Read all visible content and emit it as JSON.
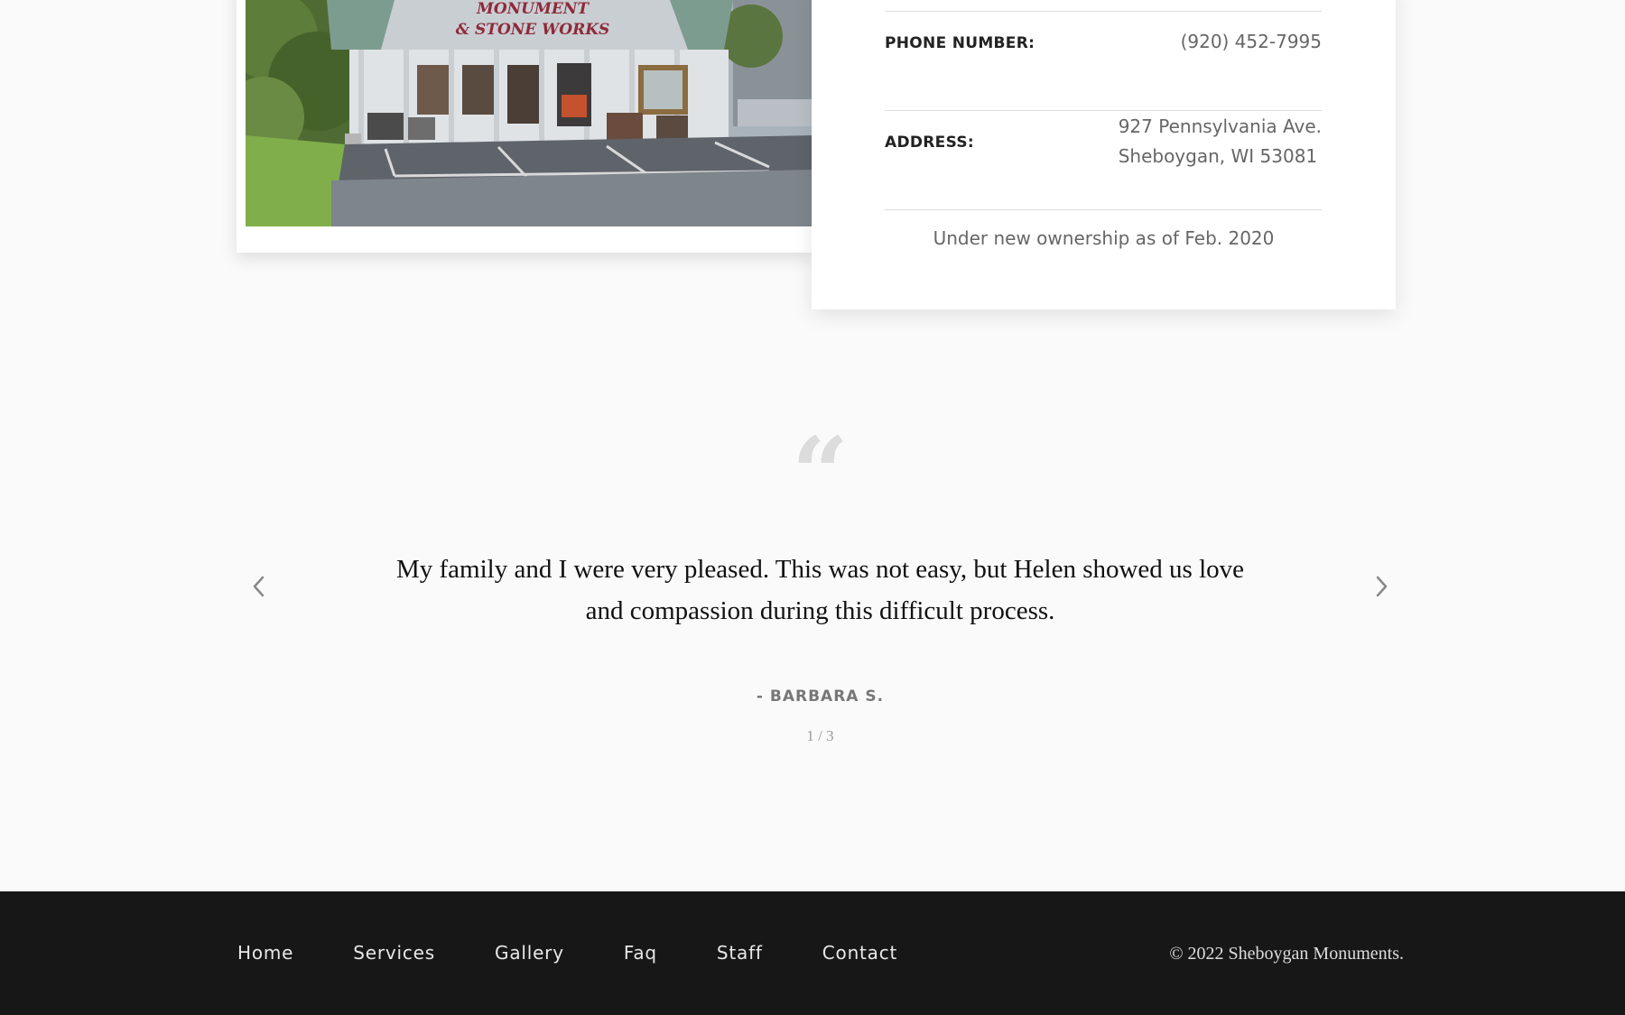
{
  "store_photo": {
    "sign_lines": [
      "MONUMENT",
      "& STONE WORKS"
    ]
  },
  "contact": {
    "phone_label": "PHONE NUMBER:",
    "phone_value": "(920) 452-7995",
    "address_label": "ADDRESS:",
    "address_line1": "927 Pennsylvania Ave.",
    "address_line2": "Sheboygan, WI 53081",
    "note": "Under new ownership as of Feb. 2020"
  },
  "testimonial": {
    "quote_mark": "“",
    "text": "My family and I were very pleased. This was not easy, but Helen showed us love and compassion during this difficult process.",
    "author": "- BARBARA S.",
    "pager": "1 / 3",
    "prev_icon": "chevron-left-icon",
    "next_icon": "chevron-right-icon"
  },
  "footer": {
    "nav": [
      "Home",
      "Services",
      "Gallery",
      "Faq",
      "Staff",
      "Contact"
    ],
    "copyright": "© 2022 Sheboygan Monuments."
  },
  "colors": {
    "page_bg": "#fafafa",
    "footer_bg": "#171717",
    "sign_text": "#8e2a3a"
  }
}
